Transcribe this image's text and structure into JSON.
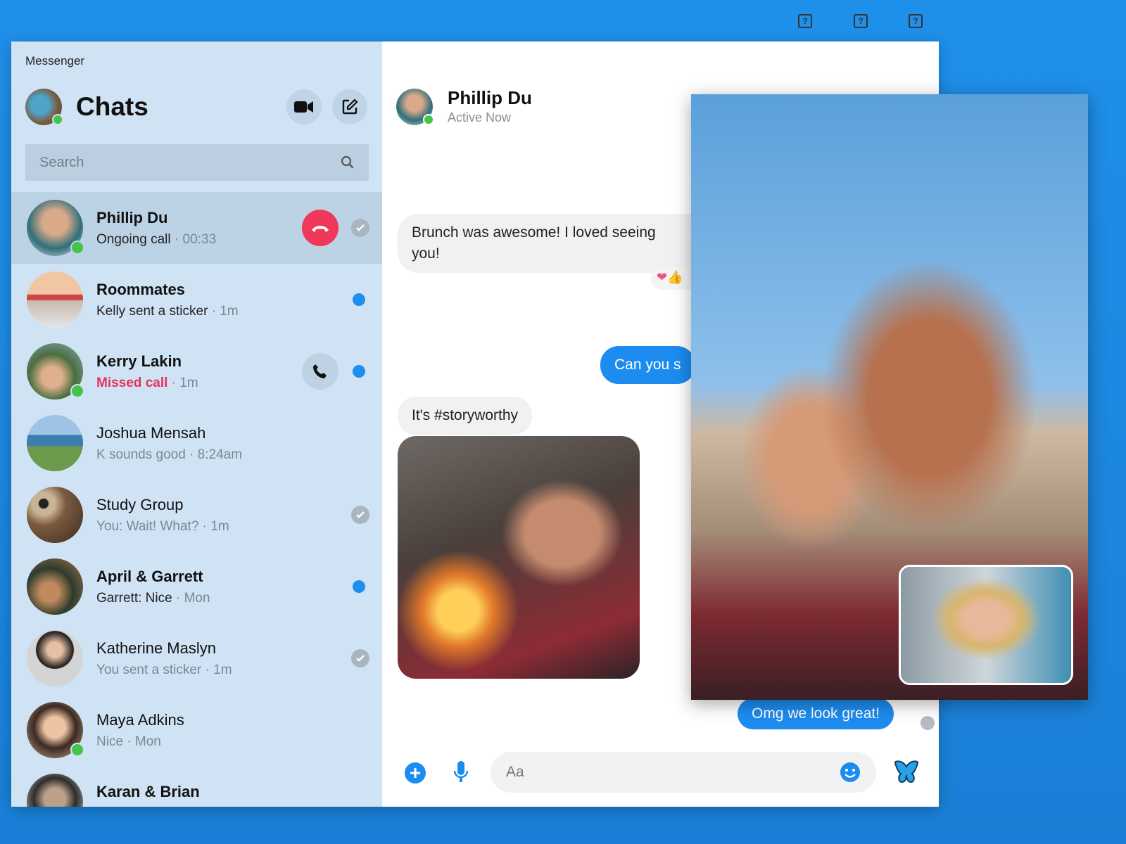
{
  "app_title": "Messenger",
  "sidebar": {
    "title": "Chats",
    "search_placeholder": "Search",
    "chats": [
      {
        "name": "Phillip Du",
        "preview": "Ongoing call",
        "time": "00:33",
        "status": "ongoing-call",
        "online": true,
        "selected": true
      },
      {
        "name": "Roommates",
        "preview": "Kelly sent a sticker",
        "time": "1m",
        "status": "unread",
        "online": false
      },
      {
        "name": "Kerry Lakin",
        "preview": "Missed call",
        "time": "1m",
        "status": "missed-call",
        "online": true
      },
      {
        "name": "Joshua Mensah",
        "preview": "K sounds good",
        "time": "8:24am",
        "status": "none",
        "online": false
      },
      {
        "name": "Study Group",
        "preview": "You: Wait! What?",
        "time": "1m",
        "status": "seen",
        "online": false
      },
      {
        "name": "April & Garrett",
        "preview": "Garrett: Nice",
        "time": "Mon",
        "status": "unread",
        "online": false
      },
      {
        "name": "Katherine Maslyn",
        "preview": "You sent a sticker",
        "time": "1m",
        "status": "seen",
        "online": false
      },
      {
        "name": "Maya Adkins",
        "preview": "Nice",
        "time": "Mon",
        "status": "none",
        "online": true
      },
      {
        "name": "Karan & Brian",
        "preview": "",
        "time": "",
        "status": "unread",
        "online": false
      }
    ]
  },
  "conversation": {
    "name": "Phillip Du",
    "status": "Active Now",
    "top_icons": [
      "?",
      "?",
      "?"
    ],
    "messages": [
      {
        "dir": "in",
        "text": "Brunch was awesome! I loved seeing",
        "text2": "you!",
        "reactions": "❤👍"
      },
      {
        "dir": "out",
        "text": "Can you s"
      },
      {
        "dir": "in",
        "text": "It's #storyworthy"
      },
      {
        "dir": "in",
        "type": "image"
      },
      {
        "dir": "out",
        "text": "Omg we look great!"
      }
    ],
    "composer_placeholder": "Aa"
  },
  "colors": {
    "accent": "#1d8cf0",
    "missed": "#e8305a",
    "online": "#45c44a",
    "end_call": "#f0385a"
  }
}
